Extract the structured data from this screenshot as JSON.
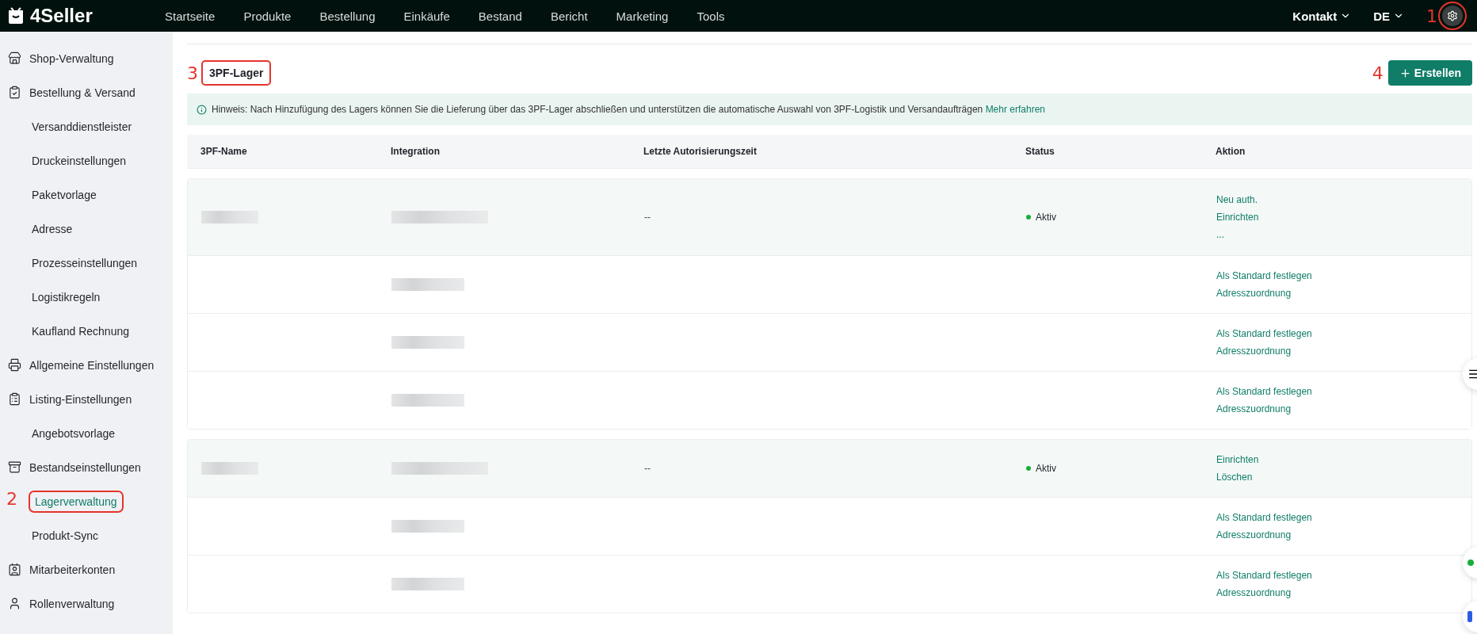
{
  "topbar": {
    "logo": "4Seller",
    "nav": [
      "Startseite",
      "Produkte",
      "Bestellung",
      "Einkäufe",
      "Bestand",
      "Bericht",
      "Marketing",
      "Tools"
    ],
    "contact": "Kontakt",
    "language": "DE",
    "settings_marker": "1"
  },
  "sidebar": {
    "items": [
      {
        "label": "Shop-Verwaltung",
        "selected": false
      },
      {
        "label": "Bestellung & Versand",
        "selected": false,
        "children": [
          {
            "label": "Versanddienstleister",
            "selected": false
          },
          {
            "label": "Druckeinstellungen",
            "selected": false
          },
          {
            "label": "Paketvorlage",
            "selected": false
          },
          {
            "label": "Adresse",
            "selected": false
          },
          {
            "label": "Prozesseinstellungen",
            "selected": false
          },
          {
            "label": "Logistikregeln",
            "selected": false
          },
          {
            "label": "Kaufland Rechnung",
            "selected": false
          }
        ]
      },
      {
        "label": "Allgemeine Einstellungen",
        "selected": false
      },
      {
        "label": "Listing-Einstellungen",
        "selected": false,
        "children": [
          {
            "label": "Angebotsvorlage",
            "selected": false
          }
        ]
      },
      {
        "label": "Bestandseinstellungen",
        "selected": false,
        "children": [
          {
            "label": "Lagerverwaltung",
            "selected": true,
            "marker": "2"
          },
          {
            "label": "Produkt-Sync",
            "selected": false
          }
        ]
      },
      {
        "label": "Mitarbeiterkonten",
        "selected": false
      },
      {
        "label": "Rollenverwaltung",
        "selected": false
      }
    ]
  },
  "tabs": [
    {
      "label": "3PF-Lager",
      "selected": true,
      "marker": "3"
    }
  ],
  "create_button": {
    "label": "Erstellen",
    "marker": "4"
  },
  "notice": {
    "text": "Hinweis: Nach Hinzufügung des Lagers können Sie die Lieferung über das 3PF-Lager abschließen und unterstützen die automatische Auswahl von 3PF-Logistik und Versandaufträgen",
    "link": "Mehr erfahren"
  },
  "table": {
    "columns": [
      "3PF-Name",
      "Integration",
      "Letzte Autorisierungszeit",
      "Status",
      "Aktion"
    ],
    "groups": [
      {
        "main": {
          "name_redacted": true,
          "integration_redacted": true,
          "last_auth": "--",
          "status": "Aktiv",
          "color": "#1aad3b",
          "actions": [
            "Neu auth.",
            "Einrichten",
            "..."
          ]
        },
        "subrows": [
          {
            "integration_redacted": true,
            "actions": [
              "Als Standard festlegen",
              "Adresszuordnung"
            ]
          },
          {
            "integration_redacted": true,
            "actions": [
              "Als Standard festlegen",
              "Adresszuordnung"
            ]
          },
          {
            "integration_redacted": true,
            "actions": [
              "Als Standard festlegen",
              "Adresszuordnung"
            ]
          }
        ]
      },
      {
        "main": {
          "name_redacted": true,
          "integration_redacted": true,
          "last_auth": "--",
          "status": "Aktiv",
          "color": "#1aad3b",
          "actions": [
            "Einrichten",
            "Löschen"
          ]
        },
        "subrows": [
          {
            "integration_redacted": true,
            "actions": [
              "Als Standard festlegen",
              "Adresszuordnung"
            ]
          },
          {
            "integration_redacted": true,
            "actions": [
              "Als Standard festlegen",
              "Adresszuordnung"
            ]
          }
        ]
      }
    ]
  }
}
